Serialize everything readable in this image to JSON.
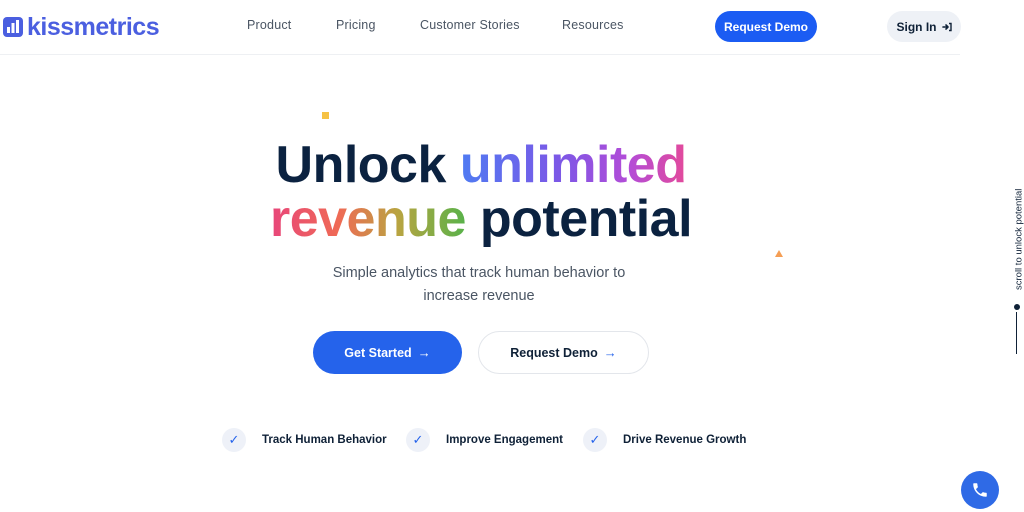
{
  "brand": {
    "name": "kissmetrics",
    "logo_icon": "bar-chart-icon",
    "color": "#4b5fe0"
  },
  "nav": {
    "links": [
      {
        "label": "Product"
      },
      {
        "label": "Pricing"
      },
      {
        "label": "Customer Stories"
      },
      {
        "label": "Resources"
      }
    ],
    "request_demo": "Request Demo",
    "sign_in": "Sign In",
    "sign_in_icon": "sign-in-icon"
  },
  "hero": {
    "line1_plain": "Unlock",
    "line1_gradient": "unlimited",
    "line2_gradient": "revenue",
    "line2_plain": "potential",
    "subtitle_line1": "Simple analytics that track human behavior to",
    "subtitle_line2": "increase revenue",
    "cta_primary": "Get Started",
    "cta_secondary": "Request Demo",
    "arrow": "→"
  },
  "features": [
    {
      "label": "Track Human Behavior",
      "icon": "check-icon"
    },
    {
      "label": "Improve Engagement",
      "icon": "check-icon"
    },
    {
      "label": "Drive Revenue Growth",
      "icon": "check-icon"
    }
  ],
  "scroll_hint": "scroll to unlock potential",
  "fab_icon": "phone-icon",
  "colors": {
    "primary": "#2563eb",
    "heading": "#0b2240",
    "accent_yellow": "#f6c244",
    "accent_orange": "#f59e54"
  }
}
